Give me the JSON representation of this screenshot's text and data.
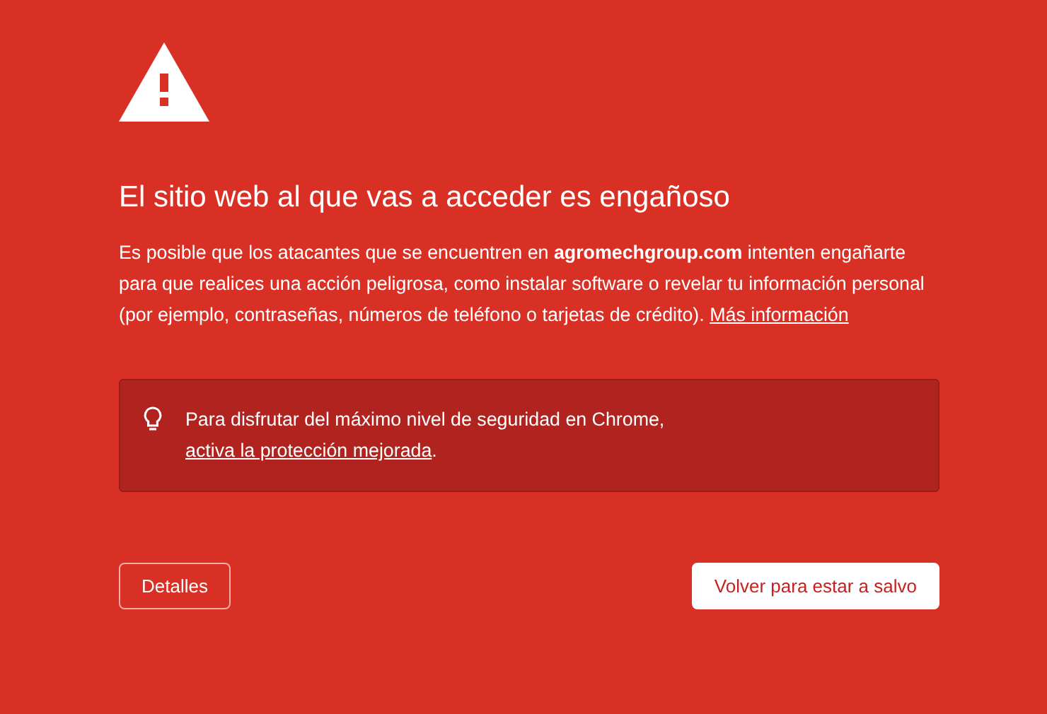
{
  "heading": "El sitio web al que vas a acceder es engañoso",
  "body": {
    "text": "Es posible que los atacantes que se encuentren en **agromechgroup.com** intenten engañarte para que realices una acción peligrosa, como instalar software o revelar tu información personal (por ejemplo, contraseñas, números de teléfono o tarjetas de crédito).",
    "link": "Más información"
  },
  "notice": {
    "text": "Para disfrutar del máximo nivel de seguridad en Chrome,",
    "link": "activa la protección mejorada",
    "end": "."
  },
  "buttons": [
    {
      "kind": "outline",
      "label": "Detalles"
    },
    {
      "kind": "primary",
      "label": "Volver para estar a salvo"
    }
  ]
}
